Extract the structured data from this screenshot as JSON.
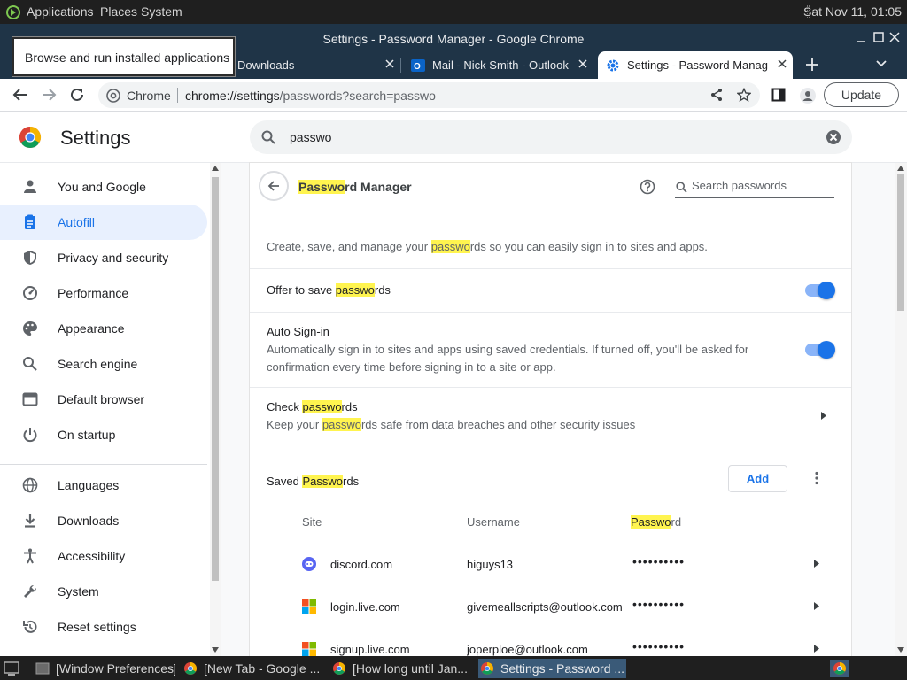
{
  "os_panel": {
    "menus": [
      "Applications",
      "Places",
      "System"
    ],
    "clock": "Sat Nov 11, 01:05"
  },
  "tooltip": "Browse and run installed applications",
  "window": {
    "title": "Settings - Password Manager - Google Chrome"
  },
  "tabs": [
    {
      "label": "Downloads",
      "active": false
    },
    {
      "label": "Mail - Nick Smith - Outlook",
      "active": false
    },
    {
      "label": "Settings - Password Manag",
      "active": true
    }
  ],
  "toolbar": {
    "site_label": "Chrome",
    "url_dark": "chrome://settings",
    "url_rest": "/passwords?search=passwo",
    "update_label": "Update"
  },
  "settings": {
    "title": "Settings",
    "search_value": "passwo"
  },
  "sidebar": {
    "items": [
      {
        "label": "You and Google",
        "icon": "person-icon"
      },
      {
        "label": "Autofill",
        "icon": "autofill-icon",
        "active": true
      },
      {
        "label": "Privacy and security",
        "icon": "shield-icon"
      },
      {
        "label": "Performance",
        "icon": "speedometer-icon"
      },
      {
        "label": "Appearance",
        "icon": "palette-icon"
      },
      {
        "label": "Search engine",
        "icon": "search-icon"
      },
      {
        "label": "Default browser",
        "icon": "browser-icon"
      },
      {
        "label": "On startup",
        "icon": "power-icon"
      },
      {
        "label": "Languages",
        "icon": "globe-icon"
      },
      {
        "label": "Downloads",
        "icon": "download-icon"
      },
      {
        "label": "Accessibility",
        "icon": "accessibility-icon"
      },
      {
        "label": "System",
        "icon": "wrench-icon"
      },
      {
        "label": "Reset settings",
        "icon": "reset-icon"
      }
    ]
  },
  "password_manager": {
    "title_hl": "Passwo",
    "title_rest": "rd Manager",
    "search_placeholder": "Search passwords",
    "description": {
      "pre": "Create, save, and manage your ",
      "hl": "passwo",
      "post": "rds so you can easily sign in to sites and apps."
    },
    "offer_save": {
      "pre": "Offer to save ",
      "hl": "passwo",
      "post": "rds",
      "enabled": true
    },
    "auto_signin": {
      "title": "Auto Sign-in",
      "desc_line1": "Automatically sign in to sites and apps using saved credentials. If turned off, you'll be asked for",
      "desc_line2": "confirmation every time before signing in to a site or app.",
      "enabled": true
    },
    "check": {
      "title_pre": "Check ",
      "title_hl": "passwo",
      "title_post": "rds",
      "desc_pre": "Keep your ",
      "desc_hl": "passwo",
      "desc_post": "rds safe from data breaches and other security issues"
    },
    "saved": {
      "title_pre": "Saved ",
      "title_hl": "Passwo",
      "title_post": "rds",
      "add_label": "Add",
      "col_site": "Site",
      "col_username": "Username",
      "col_password_hl": "Passwo",
      "col_password_rest": "rd",
      "rows": [
        {
          "site": "discord.com",
          "username": "higuys13",
          "password": "••••••••••",
          "icon": "discord-icon"
        },
        {
          "site": "login.live.com",
          "username": "givemeallscripts@outlook.com",
          "password": "••••••••••",
          "icon": "microsoft-icon"
        },
        {
          "site": "signup.live.com",
          "username": "joperploe@outlook.com",
          "password": "••••••••••",
          "icon": "microsoft-icon"
        }
      ]
    }
  },
  "taskbar": [
    {
      "label": "[Window Preferences]"
    },
    {
      "label": "[New Tab - Google ..."
    },
    {
      "label": "[How long until Jan..."
    },
    {
      "label": "Settings - Password ...",
      "active": true
    }
  ],
  "colors": {
    "accent": "#1a73e8",
    "highlight": "#fff44f",
    "titlebar": "#1f3447"
  }
}
